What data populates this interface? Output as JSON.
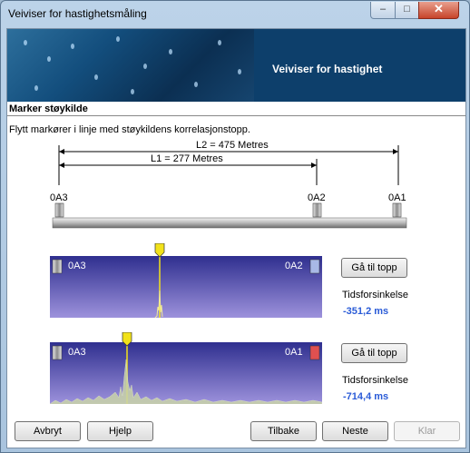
{
  "window": {
    "title": "Veiviser for hastighetsmåling",
    "controls": {
      "minimize": "–",
      "maximize": "□",
      "close": "✕"
    }
  },
  "banner": {
    "title": "Veiviser for hastighet"
  },
  "step": {
    "heading": "Marker støykilde",
    "instruction": "Flytt markører i linje med støykildens korrelasjonstopp."
  },
  "diagram": {
    "l2": "L2 = 475 Metres",
    "l1": "L1 = 277 Metres",
    "loggers": [
      "0A3",
      "0A2",
      "0A1"
    ]
  },
  "correlations": [
    {
      "left_label": "0A3",
      "right_label": "0A2",
      "button": "Gå til topp",
      "delay_label": "Tidsforsinkelse",
      "delay_value": "-351,2 ms"
    },
    {
      "left_label": "0A3",
      "right_label": "0A1",
      "button": "Gå til topp",
      "delay_label": "Tidsforsinkelse",
      "delay_value": "-714,4 ms"
    }
  ],
  "buttons": {
    "cancel": "Avbryt",
    "help": "Hjelp",
    "back": "Tilbake",
    "next": "Neste",
    "finish": "Klar"
  },
  "colors": {
    "plot_top": "#2f2f8f",
    "plot_bottom": "#9d92dc",
    "marker": "#f2e21a",
    "delay_text": "#2a5bd7",
    "banner": "#0d3f6b"
  }
}
